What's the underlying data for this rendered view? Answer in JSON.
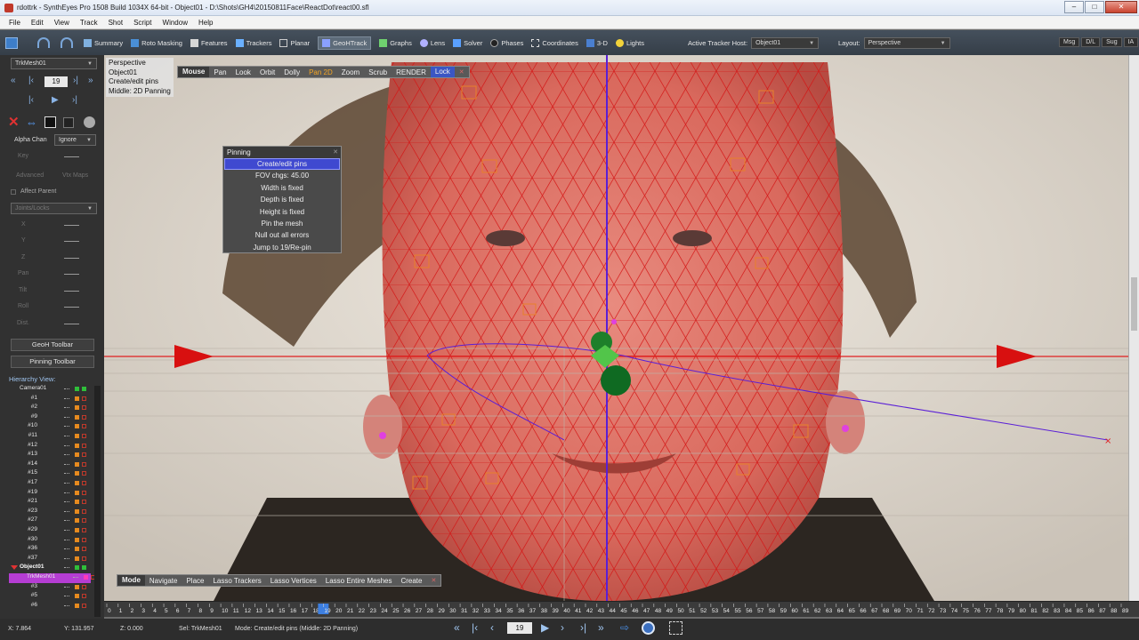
{
  "window": {
    "title": "rdottrk - SynthEyes Pro 1508 Build 1034X 64-bit - Object01 - D:\\Shots\\GH4\\20150811Face\\ReactDot\\react00.sfl",
    "minimize": "–",
    "maximize": "□",
    "close": "✕"
  },
  "menu": [
    "File",
    "Edit",
    "View",
    "Track",
    "Shot",
    "Script",
    "Window",
    "Help"
  ],
  "toolbar": {
    "items": [
      "Summary",
      "Roto Masking",
      "Features",
      "Trackers",
      "Planar",
      "GeoHTrack",
      "Graphs",
      "Lens",
      "Solver",
      "Phases",
      "Coordinates",
      "3-D",
      "Lights"
    ],
    "active_tracker_host_label": "Active Tracker Host:",
    "active_tracker_host_value": "Object01",
    "layout_label": "Layout:",
    "layout_value": "Perspective",
    "right_buttons": [
      "Msg",
      "D/L",
      "Sug",
      "IA"
    ]
  },
  "left_panel": {
    "mesh_select": "TrkMesh01",
    "frame": "19",
    "alpha_label": "Alpha Chan",
    "alpha_value": "Ignore",
    "key": "Key",
    "advanced": "Advanced",
    "vtx_maps": "Vtx Maps",
    "affect_parent": "Affect Parent",
    "joints_locks": "Joints/Locks",
    "axes": [
      "X",
      "Y",
      "Z",
      "Pan",
      "Tilt",
      "Roll",
      "Dist."
    ],
    "geoh_toolbar": "GeoH Toolbar",
    "pinning_toolbar": "Pinning Toolbar",
    "hierarchy_title": "Hierarchy View:",
    "hierarchy": [
      "Camera01",
      "#1",
      "#2",
      "#9",
      "#10",
      "#11",
      "#12",
      "#13",
      "#14",
      "#15",
      "#17",
      "#19",
      "#21",
      "#23",
      "#27",
      "#29",
      "#30",
      "#36",
      "#37",
      "Object01",
      "TrkMesh01",
      "#3",
      "#5",
      "#6"
    ]
  },
  "viewport": {
    "info": [
      "Perspective",
      "Object01",
      "Create/edit pins",
      "Middle: 2D Panning"
    ],
    "top_menu": [
      "Mouse",
      "Pan",
      "Look",
      "Orbit",
      "Dolly",
      "Pan 2D",
      "Zoom",
      "Scrub",
      "RENDER",
      "Lock"
    ],
    "bottom_menu": [
      "Mode",
      "Navigate",
      "Place",
      "Lasso Trackers",
      "Lasso Vertices",
      "Lasso Entire Meshes",
      "Create"
    ],
    "close": "✕"
  },
  "pinning": {
    "title": "Pinning",
    "items": [
      "Create/edit pins",
      "FOV chgs: 45.00",
      "Width is fixed",
      "Depth is fixed",
      "Height is fixed",
      "Pin the mesh",
      "Null out all errors",
      "Jump to 19/Re-pin"
    ]
  },
  "timeline": {
    "start": 0,
    "end": 89,
    "current": 19
  },
  "status": {
    "x": "X:   7.864",
    "y": "Y:   131.957",
    "z": "Z:   0.000",
    "sel": "Sel: TrkMesh01",
    "mode": "Mode: Create/edit pins (Middle: 2D Panning)",
    "frame": "19"
  },
  "colors": {
    "mesh": "#e02020",
    "accent": "#3f49d0",
    "active": "#f5a623",
    "axis": "#5a1fd6"
  }
}
